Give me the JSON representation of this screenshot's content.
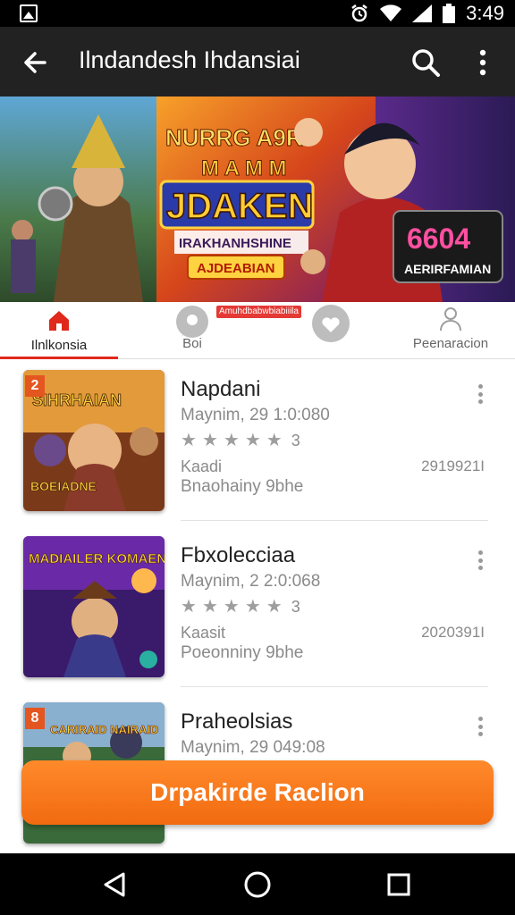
{
  "status_bar": {
    "time": "3:49"
  },
  "app_bar": {
    "title": "Ilndandesh Ihdansiai"
  },
  "banner": {
    "headline_line1": "NURRG A9R",
    "headline_line2": "M A M M",
    "headline_main": "JDAKEN",
    "headline_sub": "IRAKHANHSHINE",
    "headline_button": "AJDEABIAN",
    "badge_big": "6604",
    "badge_label": "AERIRFAMIAN"
  },
  "tabs": [
    {
      "label": "Ilnlkonsia",
      "icon": "home-icon"
    },
    {
      "label": "Boi",
      "icon": "chat-bubble-icon"
    },
    {
      "label": "",
      "icon": "heart-chat-icon"
    },
    {
      "label": "Peenaracion",
      "icon": "user-group-icon"
    }
  ],
  "promo_badge": "Amuhdbabwbiabiiila",
  "items": [
    {
      "rank": "2",
      "thumb_title": "SIHRHAIAN",
      "thumb_sub": "BOEIADNE",
      "title": "Napdani",
      "date": "Maynim, 29 1:0:080",
      "rating": "3",
      "label": "Kaadi",
      "size": "2919921I",
      "subtitle": "Bnaohainy 9bhe"
    },
    {
      "rank": "",
      "thumb_title": "MADIAILER KOMAEN",
      "thumb_sub": "",
      "title": "Fbxolecciaa",
      "date": "Maynim, 2 2:0:068",
      "rating": "3",
      "label": "Kaasit",
      "size": "2020391I",
      "subtitle": "Poeonniny 9bhe"
    },
    {
      "rank": "8",
      "thumb_title": "CARIRAID NAIRAID",
      "thumb_sub": "",
      "title": "Praheolsias",
      "date": "Maynim, 29 049:08",
      "rating": "",
      "label": "",
      "size": "",
      "subtitle": ""
    }
  ],
  "cta": {
    "label": "Drpakirde Raclion"
  },
  "colors": {
    "accent": "#f26a10",
    "tab_indicator": "#e0291b",
    "app_bar": "#222222",
    "badge": "#e4561f"
  }
}
